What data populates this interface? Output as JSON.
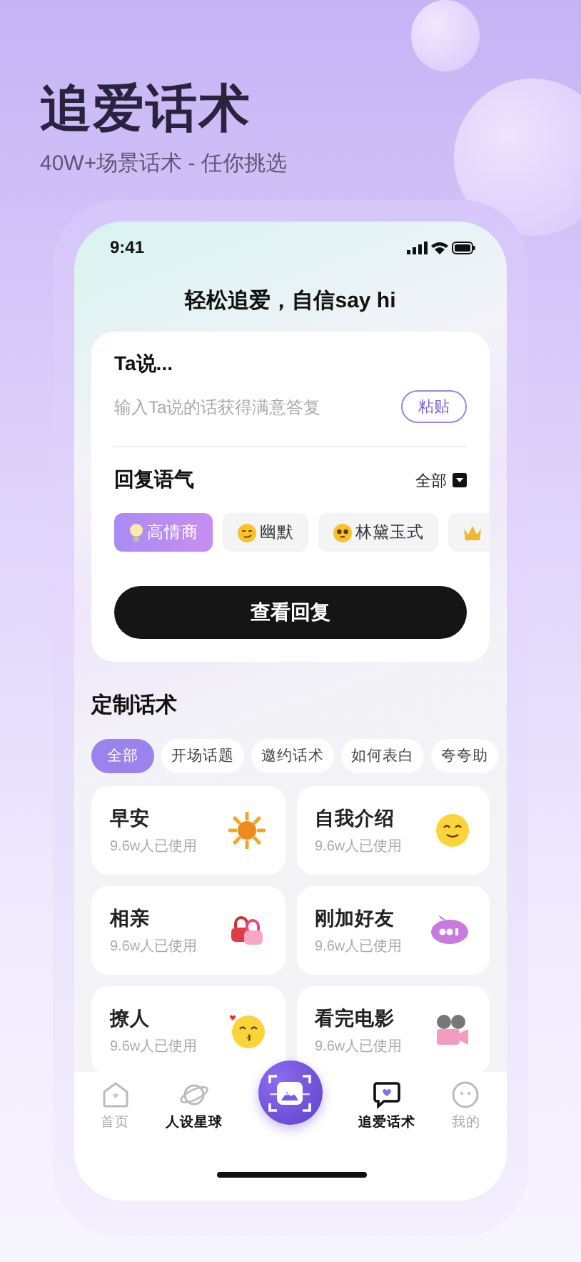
{
  "promo": {
    "title": "追爱话术",
    "subtitle": "40W+场景话术 - 任你挑选"
  },
  "status_bar": {
    "time": "9:41"
  },
  "header": {
    "title": "轻松追爱，自信say hi"
  },
  "input_card": {
    "label": "Ta说...",
    "placeholder": "输入Ta说的话获得满意答复",
    "paste_button": "粘贴",
    "tone_label": "回复语气",
    "tone_filter": "全部",
    "tones": [
      {
        "label": "高情商",
        "selected": true
      },
      {
        "label": "幽默",
        "selected": false
      },
      {
        "label": "林黛玉式",
        "selected": false
      },
      {
        "selected": false
      }
    ],
    "submit_button": "查看回复"
  },
  "custom": {
    "title": "定制话术",
    "categories": [
      {
        "label": "全部",
        "selected": true
      },
      {
        "label": "开场话题",
        "selected": false
      },
      {
        "label": "邀约话术",
        "selected": false
      },
      {
        "label": "如何表白",
        "selected": false
      },
      {
        "label": "夸夸助",
        "selected": false
      }
    ],
    "scenes": [
      {
        "title": "早安",
        "usage": "9.6w人已使用"
      },
      {
        "title": "自我介绍",
        "usage": "9.6w人已使用"
      },
      {
        "title": "相亲",
        "usage": "9.6w人已使用"
      },
      {
        "title": "刚加好友",
        "usage": "9.6w人已使用"
      },
      {
        "title": "撩人",
        "usage": "9.6w人已使用"
      },
      {
        "title": "看完电影",
        "usage": "9.6w人已使用"
      }
    ]
  },
  "tab_bar": [
    {
      "kind": "home",
      "label": "首页",
      "selected": false,
      "emphasized": false
    },
    {
      "kind": "planet",
      "label": "人设星球",
      "selected": false,
      "emphasized": true
    },
    {
      "kind": "scan",
      "selected": false
    },
    {
      "kind": "chat",
      "label": "追爱话术",
      "selected": true,
      "emphasized": true
    },
    {
      "kind": "me",
      "label": "我的",
      "selected": false,
      "emphasized": false
    }
  ]
}
